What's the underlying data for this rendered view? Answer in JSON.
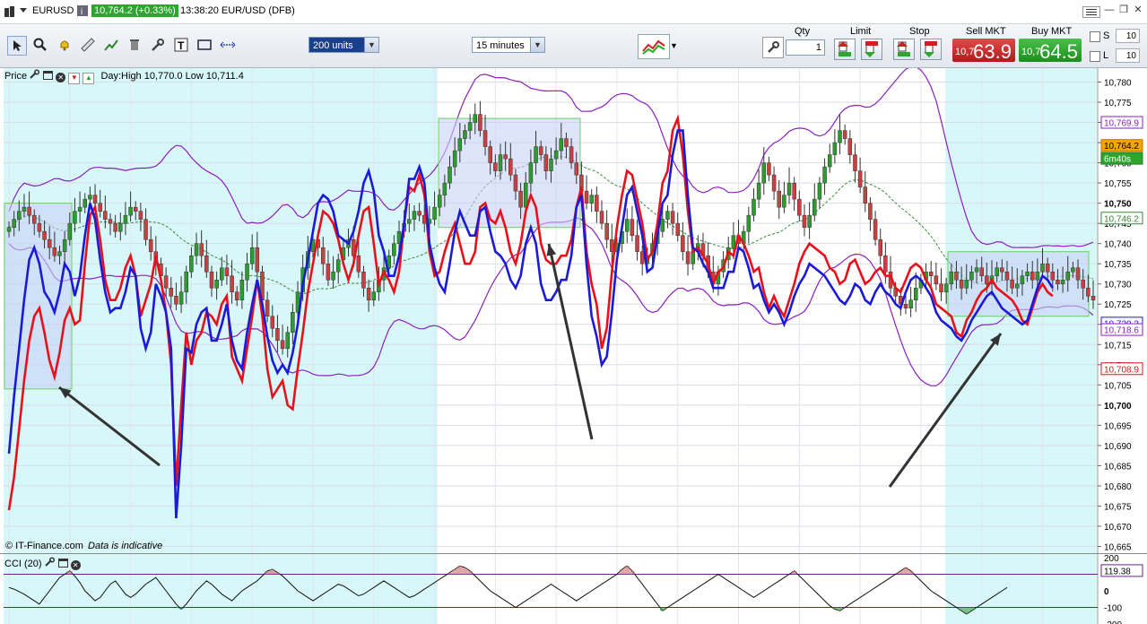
{
  "window": {
    "symbol": "EURUSD",
    "quote": "10,764.2 (+0.33%)",
    "time_desc": "13:38:20 EUR/USD (DFB)"
  },
  "toolbar": {
    "units": "200 units",
    "interval": "15 minutes",
    "qty_label": "Qty",
    "qty_value": "1",
    "limit_label": "Limit",
    "stop_label": "Stop",
    "sell_label": "Sell MKT",
    "sell_small": "10,7",
    "sell_big": "63.9",
    "buy_label": "Buy MKT",
    "buy_small": "10,7",
    "buy_big": "64.5",
    "s_label": "S",
    "l_label": "L",
    "s_value": "10",
    "l_value": "10"
  },
  "legend": {
    "price_label": "Price",
    "day_info": "Day:High 10,770.0 Low 10,711.4",
    "cci_label": "CCI (20)"
  },
  "footer": {
    "copyright": "© IT-Finance.com",
    "note": "Data is indicative"
  },
  "colors": {
    "red_line": "#e8101a",
    "blue_line": "#1a1ad8",
    "band": "#8a20c0",
    "highlight_bg": "#d8f7f9",
    "box_fill": "#c8d2f5",
    "box_border": "#6ad06a",
    "candle_up": "#2e9b2e",
    "candle_down": "#c84040",
    "sell": "#d22b2b",
    "buy": "#2ea52e"
  },
  "chart_data": {
    "type": "candlestick",
    "ylim": [
      10664,
      10783
    ],
    "yticks": [
      "10,780",
      "10,775",
      "10,770",
      "10,765",
      "10,760",
      "10,755",
      "10,750",
      "10,745",
      "10,740",
      "10,735",
      "10,730",
      "10,725",
      "10,720",
      "10,715",
      "10,710",
      "10,705",
      "10,700",
      "10,695",
      "10,690",
      "10,685",
      "10,680",
      "10,675",
      "10,670",
      "10,665"
    ],
    "bold_ticks": [
      "10,750",
      "10,700"
    ],
    "price_tags": [
      {
        "value": 10769.9,
        "text": "10,769.9",
        "style": "purple"
      },
      {
        "value": 10764.2,
        "text": "10,764.2",
        "style": "current"
      },
      {
        "value": 10761.0,
        "text": "6m40s",
        "style": "timer"
      },
      {
        "value": 10746.2,
        "text": "10,746.2",
        "style": "green"
      },
      {
        "value": 10720.2,
        "text": "10,720.2",
        "style": "blue"
      },
      {
        "value": 10718.6,
        "text": "10,718.6",
        "style": "purple"
      },
      {
        "value": 10708.9,
        "text": "10,708.9",
        "style": "red"
      }
    ],
    "close": [
      10744,
      10746,
      10748,
      10749,
      10747,
      10745,
      10743,
      10741,
      10739,
      10737,
      10738,
      10741,
      10745,
      10748,
      10749,
      10751,
      10752,
      10750,
      10748,
      10746,
      10745,
      10743,
      10745,
      10747,
      10749,
      10748,
      10746,
      10741,
      10738,
      10735,
      10732,
      10729,
      10727,
      10725,
      10728,
      10733,
      10737,
      10740,
      10737,
      10733,
      10729,
      10731,
      10734,
      10732,
      10728,
      10726,
      10731,
      10735,
      10739,
      10733,
      10726,
      10722,
      10719,
      10716,
      10714,
      10718,
      10723,
      10728,
      10734,
      10738,
      10741,
      10739,
      10735,
      10731,
      10733,
      10736,
      10739,
      10741,
      10737,
      10733,
      10729,
      10726,
      10728,
      10731,
      10734,
      10737,
      10740,
      10743,
      10745,
      10746,
      10748,
      10747,
      10745,
      10746,
      10749,
      10752,
      10755,
      10759,
      10763,
      10766,
      10768,
      10770,
      10772,
      10768,
      10764,
      10760,
      10758,
      10762,
      10761,
      10757,
      10753,
      10749,
      10755,
      10760,
      10764,
      10762,
      10758,
      10761,
      10763,
      10766,
      10764,
      10760,
      10757,
      10753,
      10750,
      10752,
      10748,
      10745,
      10741,
      10738,
      10740,
      10743,
      10746,
      10742,
      10738,
      10735,
      10737,
      10740,
      10743,
      10746,
      10748,
      10745,
      10742,
      10738,
      10735,
      10738,
      10740,
      10737,
      10733,
      10730,
      10733,
      10736,
      10739,
      10742,
      10740,
      10743,
      10747,
      10751,
      10755,
      10760,
      10757,
      10753,
      10749,
      10752,
      10755,
      10751,
      10747,
      10744,
      10747,
      10751,
      10755,
      10759,
      10762,
      10765,
      10768,
      10766,
      10762,
      10758,
      10754,
      10750,
      10746,
      10741,
      10737,
      10733,
      10729,
      10727,
      10725,
      10724,
      10726,
      10729,
      10731,
      10733,
      10732,
      10730,
      10728,
      10730,
      10733,
      10731,
      10729,
      10731,
      10733,
      10734,
      10732,
      10730,
      10732,
      10734,
      10733,
      10731,
      10729,
      10730,
      10732,
      10733,
      10731,
      10733,
      10735,
      10733,
      10731,
      10730,
      10731,
      10733,
      10734,
      10731,
      10729,
      10727,
      10726
    ],
    "red_line": [
      10674,
      10682,
      10694,
      10706,
      10716,
      10722,
      10724,
      10718,
      10711,
      10707,
      10713,
      10721,
      10724,
      10720,
      10721,
      10735,
      10747,
      10749,
      10741,
      10731,
      10726,
      10726,
      10729,
      10734,
      10737,
      10732,
      10722,
      10726,
      10730,
      10737,
      10731,
      10723,
      10710,
      10680,
      10700,
      10718,
      10710,
      10716,
      10718,
      10723,
      10722,
      10720,
      10725,
      10727,
      10712,
      10709,
      10706,
      10714,
      10722,
      10731,
      10722,
      10709,
      10702,
      10704,
      10706,
      10700,
      10699,
      10709,
      10718,
      10728,
      10735,
      10742,
      10748,
      10747,
      10745,
      10741,
      10735,
      10731,
      10735,
      10742,
      10748,
      10749,
      10740,
      10730,
      10733,
      10731,
      10728,
      10733,
      10745,
      10754,
      10753,
      10757,
      10752,
      10738,
      10732,
      10733,
      10738,
      10742,
      10745,
      10740,
      10735,
      10735,
      10738,
      10749,
      10750,
      10746,
      10745,
      10748,
      10744,
      10738,
      10735,
      10740,
      10748,
      10752,
      10749,
      10740,
      10736,
      10735,
      10735,
      10737,
      10737,
      10741,
      10749,
      10754,
      10738,
      10730,
      10725,
      10714,
      10719,
      10733,
      10744,
      10752,
      10758,
      10757,
      10751,
      10745,
      10736,
      10738,
      10745,
      10755,
      10758,
      10768,
      10771,
      10762,
      10748,
      10738,
      10739,
      10737,
      10735,
      10730,
      10733,
      10734,
      10738,
      10737,
      10742,
      10740,
      10737,
      10733,
      10734,
      10728,
      10724,
      10727,
      10724,
      10722,
      10726,
      10730,
      10735,
      10738,
      10740,
      10739,
      10738,
      10737,
      10734,
      10733,
      10730,
      10731,
      10735,
      10736,
      10733,
      10730,
      10731,
      10733,
      10734,
      10732,
      10732,
      10729,
      10728,
      10731,
      10734,
      10735,
      10734,
      10731,
      10729,
      10725,
      10724,
      10723,
      10722,
      10718,
      10717,
      10721,
      10723,
      10726,
      10728,
      10729,
      10731,
      10729,
      10728,
      10727,
      10726,
      10724,
      10721,
      10720,
      10724,
      10728,
      10730,
      10728,
      10727
    ],
    "blue_line": [
      10688,
      10702,
      10714,
      10726,
      10736,
      10739,
      10735,
      10728,
      10726,
      10723,
      10728,
      10735,
      10733,
      10727,
      10732,
      10742,
      10750,
      10746,
      10736,
      10728,
      10723,
      10724,
      10724,
      10728,
      10734,
      10732,
      10719,
      10714,
      10718,
      10730,
      10727,
      10723,
      10714,
      10672,
      10690,
      10714,
      10713,
      10720,
      10723,
      10724,
      10716,
      10716,
      10720,
      10725,
      10716,
      10711,
      10709,
      10718,
      10725,
      10731,
      10725,
      10717,
      10711,
      10708,
      10710,
      10708,
      10713,
      10720,
      10730,
      10736,
      10743,
      10750,
      10752,
      10751,
      10748,
      10742,
      10741,
      10740,
      10743,
      10748,
      10755,
      10758,
      10753,
      10742,
      10738,
      10732,
      10732,
      10737,
      10745,
      10756,
      10756,
      10759,
      10755,
      10740,
      10734,
      10730,
      10728,
      10735,
      10743,
      10748,
      10745,
      10742,
      10742,
      10748,
      10749,
      10743,
      10738,
      10737,
      10735,
      10731,
      10729,
      10732,
      10740,
      10744,
      10740,
      10730,
      10726,
      10726,
      10728,
      10731,
      10731,
      10737,
      10749,
      10752,
      10735,
      10722,
      10717,
      10710,
      10712,
      10723,
      10736,
      10744,
      10752,
      10754,
      10748,
      10742,
      10733,
      10734,
      10742,
      10750,
      10752,
      10762,
      10768,
      10768,
      10752,
      10739,
      10738,
      10735,
      10733,
      10729,
      10729,
      10729,
      10733,
      10733,
      10739,
      10738,
      10734,
      10729,
      10730,
      10726,
      10723,
      10725,
      10723,
      10720,
      10723,
      10727,
      10730,
      10732,
      10735,
      10734,
      10733,
      10732,
      10730,
      10728,
      10726,
      10725,
      10727,
      10730,
      10729,
      10726,
      10725,
      10728,
      10730,
      10728,
      10727,
      10725,
      10724,
      10728,
      10731,
      10732,
      10731,
      10729,
      10727,
      10723,
      10721,
      10720,
      10719,
      10717,
      10716,
      10718,
      10721,
      10723,
      10725,
      10727,
      10728,
      10726,
      10724,
      10723,
      10722,
      10721,
      10720,
      10721,
      10725,
      10729,
      10732,
      10731,
      10729
    ],
    "cci": [
      20,
      10,
      -5,
      -20,
      -40,
      -60,
      -80,
      -40,
      0,
      40,
      80,
      100,
      120,
      90,
      50,
      0,
      -30,
      -60,
      -40,
      0,
      40,
      60,
      20,
      -20,
      -40,
      -20,
      10,
      40,
      60,
      80,
      40,
      0,
      -40,
      -80,
      -110,
      -80,
      -40,
      0,
      30,
      60,
      40,
      10,
      -20,
      -40,
      -60,
      -30,
      0,
      20,
      40,
      60,
      90,
      120,
      130,
      110,
      90,
      60,
      30,
      0,
      -20,
      -40,
      -60,
      -40,
      -20,
      0,
      20,
      40,
      30,
      10,
      -10,
      -30,
      -20,
      0,
      20,
      40,
      60,
      40,
      20,
      0,
      -20,
      -40,
      -30,
      -10,
      10,
      30,
      50,
      70,
      90,
      110,
      130,
      150,
      140,
      120,
      90,
      60,
      30,
      0,
      -20,
      -40,
      -60,
      -80,
      -100,
      -80,
      -60,
      -40,
      -20,
      0,
      20,
      40,
      20,
      0,
      -20,
      -40,
      -60,
      -40,
      -20,
      0,
      20,
      40,
      60,
      80,
      100,
      130,
      150,
      120,
      80,
      40,
      0,
      -40,
      -80,
      -120,
      -100,
      -80,
      -60,
      -40,
      -20,
      0,
      20,
      40,
      60,
      80,
      100,
      80,
      60,
      40,
      20,
      0,
      -20,
      -40,
      -20,
      0,
      20,
      40,
      60,
      80,
      100,
      120,
      90,
      60,
      30,
      0,
      -30,
      -60,
      -90,
      -110,
      -120,
      -100,
      -80,
      -60,
      -40,
      -20,
      0,
      20,
      40,
      60,
      80,
      100,
      120,
      140,
      120,
      90,
      60,
      30,
      0,
      -20,
      -40,
      -60,
      -80,
      -100,
      -120,
      -140,
      -120,
      -100,
      -80,
      -60,
      -40,
      -20,
      0,
      20
    ]
  }
}
